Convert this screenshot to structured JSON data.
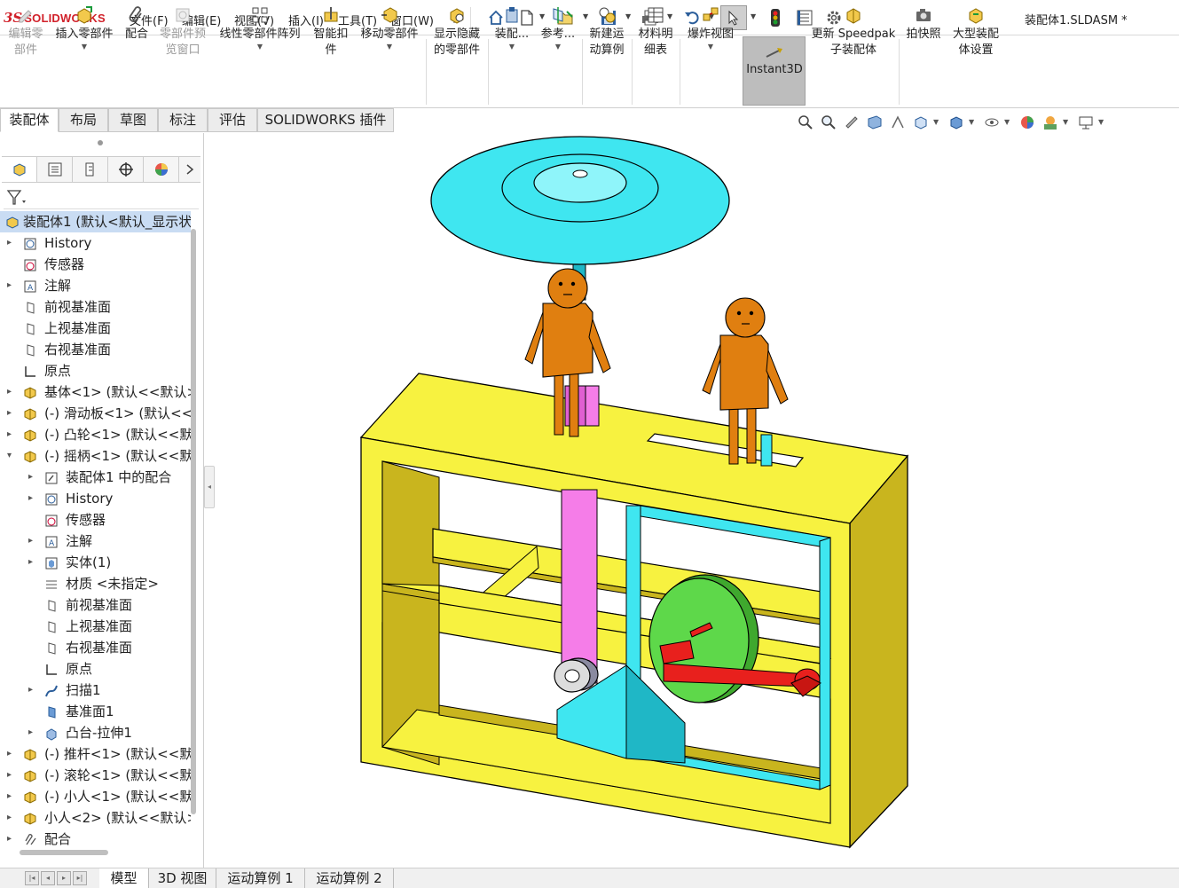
{
  "app": {
    "brand_prefix": "3S",
    "brand_name": "SOLIDWORKS",
    "document_title": "装配体1.SLDASM *"
  },
  "menu": [
    "文件(F)",
    "编辑(E)",
    "视图(V)",
    "插入(I)",
    "工具(T)",
    "窗口(W)"
  ],
  "commands": [
    {
      "label": "编辑零\n部件",
      "icon": "edit-component-icon",
      "enabled": false
    },
    {
      "label": "插入零部件",
      "icon": "insert-component-icon",
      "enabled": true
    },
    {
      "label": "配合",
      "icon": "mate-icon",
      "enabled": true
    },
    {
      "label": "零部件预\n览窗口",
      "icon": "component-preview-icon",
      "enabled": false
    },
    {
      "label": "线性零部件阵列",
      "icon": "linear-pattern-icon",
      "enabled": true
    },
    {
      "label": "智能扣\n件",
      "icon": "smart-fastener-icon",
      "enabled": true
    },
    {
      "label": "移动零部件",
      "icon": "move-component-icon",
      "enabled": true
    },
    {
      "label": "显示隐藏\n的零部件",
      "icon": "show-hidden-icon",
      "enabled": true
    },
    {
      "label": "装配...",
      "icon": "assembly-features-icon",
      "enabled": true
    },
    {
      "label": "参考...",
      "icon": "reference-geometry-icon",
      "enabled": true
    },
    {
      "label": "新建运\n动算例",
      "icon": "new-motion-study-icon",
      "enabled": true
    },
    {
      "label": "材料明\n细表",
      "icon": "bom-icon",
      "enabled": true
    },
    {
      "label": "爆炸视图",
      "icon": "exploded-view-icon",
      "enabled": true
    },
    {
      "label": "Instant3D",
      "icon": "instant3d-icon",
      "enabled": true,
      "active": true
    },
    {
      "label": "更新 Speedpak\n子装配体",
      "icon": "speedpak-icon",
      "enabled": true
    },
    {
      "label": "拍快照",
      "icon": "snapshot-icon",
      "enabled": true
    },
    {
      "label": "大型装配\n体设置",
      "icon": "large-assembly-icon",
      "enabled": true
    }
  ],
  "tabs": [
    {
      "label": "装配体",
      "active": true
    },
    {
      "label": "布局",
      "active": false
    },
    {
      "label": "草图",
      "active": false
    },
    {
      "label": "标注",
      "active": false
    },
    {
      "label": "评估",
      "active": false
    },
    {
      "label": "SOLIDWORKS 插件",
      "active": false
    }
  ],
  "tree": {
    "root": "装配体1 (默认<默认_显示状",
    "items": [
      {
        "label": "History",
        "icon": "history-icon",
        "expandable": true,
        "level": 1
      },
      {
        "label": "传感器",
        "icon": "sensor-icon",
        "expandable": false,
        "level": 1
      },
      {
        "label": "注解",
        "icon": "annotation-icon",
        "expandable": true,
        "level": 1
      },
      {
        "label": "前视基准面",
        "icon": "plane-icon",
        "expandable": false,
        "level": 1
      },
      {
        "label": "上视基准面",
        "icon": "plane-icon",
        "expandable": false,
        "level": 1
      },
      {
        "label": "右视基准面",
        "icon": "plane-icon",
        "expandable": false,
        "level": 1
      },
      {
        "label": "原点",
        "icon": "origin-icon",
        "expandable": false,
        "level": 1
      },
      {
        "label": "基体<1> (默认<<默认>",
        "icon": "part-icon",
        "expandable": true,
        "level": 1
      },
      {
        "label": "(-) 滑动板<1> (默认<<",
        "icon": "part-icon",
        "expandable": true,
        "level": 1
      },
      {
        "label": "(-) 凸轮<1> (默认<<默",
        "icon": "part-icon",
        "expandable": true,
        "level": 1
      },
      {
        "label": "(-) 摇柄<1> (默认<<默",
        "icon": "part-icon",
        "expandable": true,
        "expanded": true,
        "level": 1
      },
      {
        "label": "装配体1 中的配合",
        "icon": "mates-in-assembly-icon",
        "expandable": true,
        "level": 2
      },
      {
        "label": "History",
        "icon": "history-icon",
        "expandable": true,
        "level": 2
      },
      {
        "label": "传感器",
        "icon": "sensor-icon",
        "expandable": false,
        "level": 2
      },
      {
        "label": "注解",
        "icon": "annotation-icon",
        "expandable": true,
        "level": 2
      },
      {
        "label": "实体(1)",
        "icon": "solid-body-icon",
        "expandable": true,
        "level": 2
      },
      {
        "label": "材质 <未指定>",
        "icon": "material-icon",
        "expandable": false,
        "level": 2
      },
      {
        "label": "前视基准面",
        "icon": "plane-icon",
        "expandable": false,
        "level": 2
      },
      {
        "label": "上视基准面",
        "icon": "plane-icon",
        "expandable": false,
        "level": 2
      },
      {
        "label": "右视基准面",
        "icon": "plane-icon",
        "expandable": false,
        "level": 2
      },
      {
        "label": "原点",
        "icon": "origin-icon",
        "expandable": false,
        "level": 2
      },
      {
        "label": "扫描1",
        "icon": "sweep-icon",
        "expandable": true,
        "level": 2
      },
      {
        "label": "基准面1",
        "icon": "plane-feature-icon",
        "expandable": false,
        "level": 2
      },
      {
        "label": "凸台-拉伸1",
        "icon": "extrude-icon",
        "expandable": true,
        "level": 2
      },
      {
        "label": "(-) 推杆<1> (默认<<默",
        "icon": "part-icon",
        "expandable": true,
        "level": 1
      },
      {
        "label": "(-) 滚轮<1> (默认<<默",
        "icon": "part-icon",
        "expandable": true,
        "level": 1
      },
      {
        "label": "(-) 小人<1> (默认<<默",
        "icon": "part-icon",
        "expandable": true,
        "level": 1
      },
      {
        "label": "小人<2> (默认<<默认>",
        "icon": "part-icon",
        "expandable": true,
        "level": 1
      },
      {
        "label": "配合",
        "icon": "mates-icon",
        "expandable": true,
        "level": 1
      }
    ]
  },
  "bottom_tabs": [
    {
      "label": "模型",
      "active": true
    },
    {
      "label": "3D 视图",
      "active": false
    },
    {
      "label": "运动算例 1",
      "active": false
    },
    {
      "label": "运动算例 2",
      "active": false
    }
  ],
  "colors": {
    "frame_yellow": "#f7f240",
    "frame_dark": "#c9b51e",
    "disc_cyan": "#3fe6f0",
    "figure_orange": "#e07f10",
    "pusher_pink": "#f57de8",
    "cam_green": "#5ed84a",
    "crank_red": "#e8201d",
    "instant3d_bg": "#bdbdbd"
  }
}
